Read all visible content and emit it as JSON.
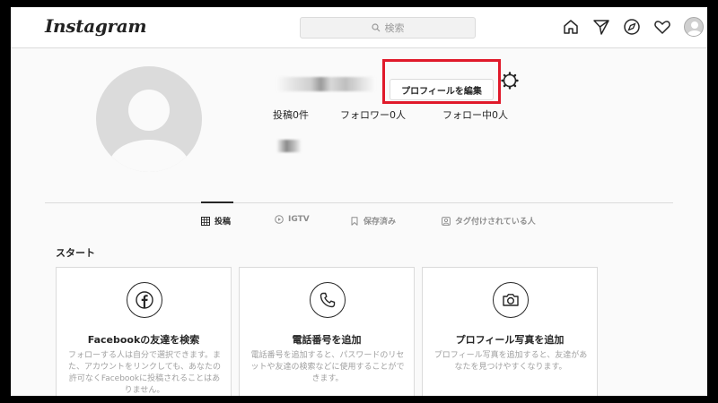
{
  "header": {
    "logo": "Instagram",
    "search_placeholder": "検索"
  },
  "profile": {
    "edit_button": "プロフィールを編集",
    "stats": {
      "posts": "投稿0件",
      "followers": "フォロワー0人",
      "following": "フォロー中0人"
    }
  },
  "tabs": [
    {
      "label": "投稿",
      "icon": "grid-icon",
      "active": true
    },
    {
      "label": "IGTV",
      "icon": "igtv-icon",
      "active": false
    },
    {
      "label": "保存済み",
      "icon": "bookmark-icon",
      "active": false
    },
    {
      "label": "タグ付けされている人",
      "icon": "tag-icon",
      "active": false
    }
  ],
  "start": {
    "title": "スタート",
    "cards": [
      {
        "title": "Facebookの友達を検索",
        "icon": "facebook-icon",
        "description": "フォローする人は自分で選択できます。また、アカウントをリンクしても、あなたの許可なくFacebookに投稿されることはありません。"
      },
      {
        "title": "電話番号を追加",
        "icon": "phone-icon",
        "description": "電話番号を追加すると、パスワードのリセットや友達の検索などに使用することができます。"
      },
      {
        "title": "プロフィール写真を追加",
        "icon": "camera-icon",
        "description": "プロフィール写真を追加すると、友達があなたを見つけやすくなります。"
      }
    ]
  },
  "colors": {
    "highlight": "#e0192a",
    "background": "#fafafa",
    "border": "#dbdbdb"
  }
}
